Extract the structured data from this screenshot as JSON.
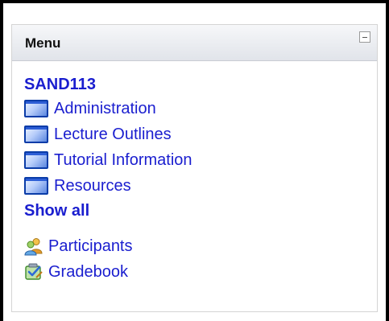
{
  "block": {
    "title": "Menu",
    "course": "SAND113",
    "topics": [
      {
        "label": "Administration",
        "icon": "topic-folder-icon"
      },
      {
        "label": "Lecture Outlines",
        "icon": "topic-folder-icon"
      },
      {
        "label": "Tutorial Information",
        "icon": "topic-folder-icon"
      },
      {
        "label": "Resources",
        "icon": "topic-folder-icon"
      }
    ],
    "show_all": "Show all",
    "participants": {
      "label": "Participants",
      "icon": "participants-icon"
    },
    "gradebook": {
      "label": "Gradebook",
      "icon": "gradebook-icon"
    }
  },
  "colors": {
    "link": "#1a1ecf",
    "header_bg": "#e1e4ea",
    "frame": "#000000"
  }
}
